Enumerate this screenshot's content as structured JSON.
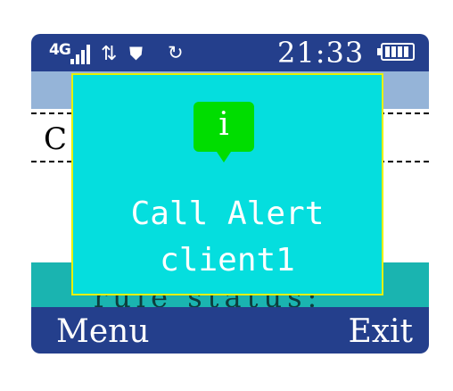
{
  "status_bar": {
    "network_label": "4G",
    "clock": "21:33",
    "icons": [
      "signal-bars-icon",
      "data-transfer-icon",
      "shield-icon",
      "sync-icon",
      "battery-icon"
    ]
  },
  "list": {
    "row_text": "C",
    "footer_text": "rule status:"
  },
  "dialog": {
    "icon": "info-icon",
    "icon_glyph": "i",
    "title": "Call Alert",
    "subtitle": "client1"
  },
  "softkeys": {
    "left_label": "Menu",
    "right_label": "Exit"
  },
  "colors": {
    "bar_blue": "#243f8c",
    "subheader_blue": "#95b4d8",
    "dialog_cyan": "#05dede",
    "dialog_border": "#e8f000",
    "info_green": "#00dd00",
    "teal_row": "#1ab4b0"
  }
}
